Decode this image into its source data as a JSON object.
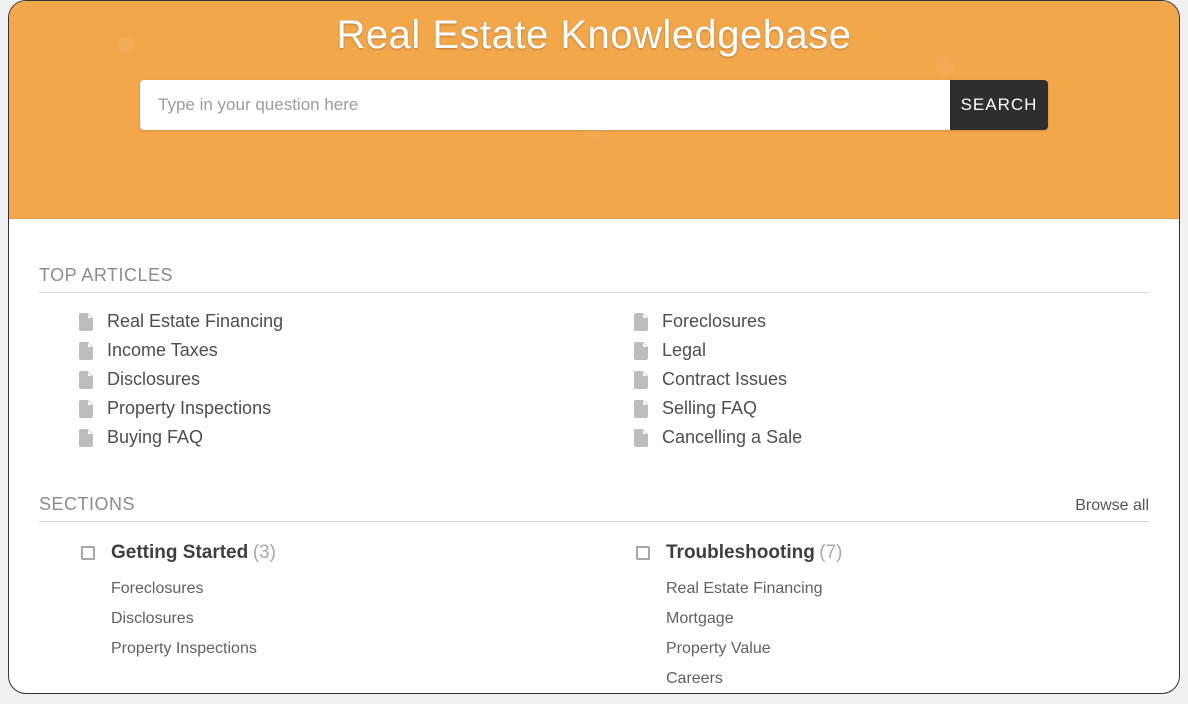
{
  "hero": {
    "title": "Real Estate Knowledgebase"
  },
  "search": {
    "placeholder": "Type in your question here",
    "button": "SEARCH"
  },
  "top_articles": {
    "heading": "TOP ARTICLES",
    "left": [
      "Real Estate Financing",
      "Income Taxes",
      "Disclosures",
      "Property Inspections",
      "Buying FAQ"
    ],
    "right": [
      "Foreclosures",
      "Legal",
      "Contract Issues",
      "Selling FAQ",
      "Cancelling a Sale"
    ]
  },
  "sections": {
    "heading": "SECTIONS",
    "browse_all": "Browse all",
    "left": {
      "title": "Getting Started",
      "count": "(3)",
      "items": [
        "Foreclosures",
        "Disclosures",
        "Property Inspections"
      ]
    },
    "right": {
      "title": "Troubleshooting",
      "count": "(7)",
      "items": [
        "Real Estate Financing",
        "Mortgage",
        "Property Value",
        "Careers"
      ]
    }
  }
}
